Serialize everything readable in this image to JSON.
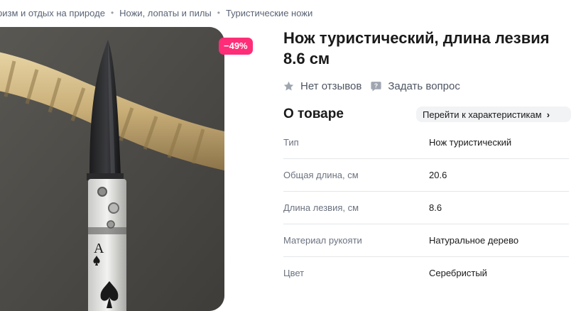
{
  "breadcrumbs": [
    "ризм и отдых на природе",
    "Ножи, лопаты и пилы",
    "Туристические ножи"
  ],
  "breadcrumb_separator": "•",
  "product": {
    "discount_badge": "−49%",
    "title": "Нож туристический, длина лезвия 8.6 см",
    "reviews_label": "Нет отзывов",
    "ask_label": "Задать вопрос",
    "image_card_text": "A"
  },
  "about": {
    "title": "О товаре",
    "link_label": "Перейти к характеристикам",
    "link_chevron": "›"
  },
  "specs": [
    {
      "key": "Тип",
      "value": "Нож туристический"
    },
    {
      "key": "Общая длина, см",
      "value": "20.6"
    },
    {
      "key": "Длина лезвия, см",
      "value": "8.6"
    },
    {
      "key": "Материал рукояти",
      "value": "Натуральное дерево"
    },
    {
      "key": "Цвет",
      "value": "Серебристый"
    }
  ],
  "colors": {
    "badge": "#ff2d77",
    "text_primary": "#1a1a1a",
    "text_secondary": "#6b7280",
    "link_bg": "#f2f3f5"
  },
  "icons": [
    "star-icon",
    "question-bubble-icon",
    "chevron-right-icon"
  ]
}
